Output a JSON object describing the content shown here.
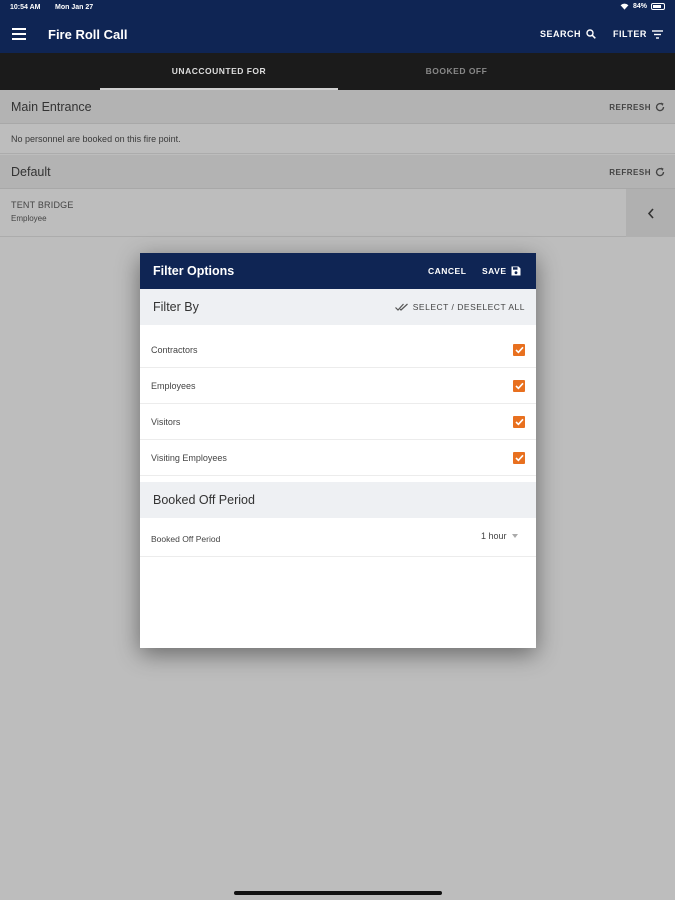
{
  "status_bar": {
    "time": "10:54 AM",
    "date": "Mon Jan 27",
    "battery": "84%"
  },
  "app_bar": {
    "title": "Fire Roll Call",
    "search_label": "SEARCH",
    "filter_label": "FILTER"
  },
  "tabs": [
    {
      "label": "UNACCOUNTED FOR",
      "active": true
    },
    {
      "label": "BOOKED OFF",
      "active": false
    }
  ],
  "fire_points": [
    {
      "name": "Main Entrance",
      "refresh_label": "REFRESH",
      "empty_message": "No personnel are booked on this fire point."
    },
    {
      "name": "Default",
      "refresh_label": "REFRESH",
      "people": [
        {
          "name": "TENT BRIDGE",
          "role": "Employee"
        }
      ]
    }
  ],
  "filter_dialog": {
    "title": "Filter Options",
    "cancel_label": "CANCEL",
    "save_label": "SAVE",
    "filter_by_title": "Filter By",
    "select_all_label": "SELECT / DESELECT ALL",
    "options": [
      {
        "label": "Contractors",
        "checked": true
      },
      {
        "label": "Employees",
        "checked": true
      },
      {
        "label": "Visitors",
        "checked": true
      },
      {
        "label": "Visiting Employees",
        "checked": true
      }
    ],
    "booked_off_title": "Booked Off Period",
    "booked_off_label": "Booked Off Period",
    "booked_off_value": "1 hour"
  },
  "colors": {
    "primary": "#0f2554",
    "accent": "#e8701f",
    "tab_bar": "#1b1b1b"
  }
}
